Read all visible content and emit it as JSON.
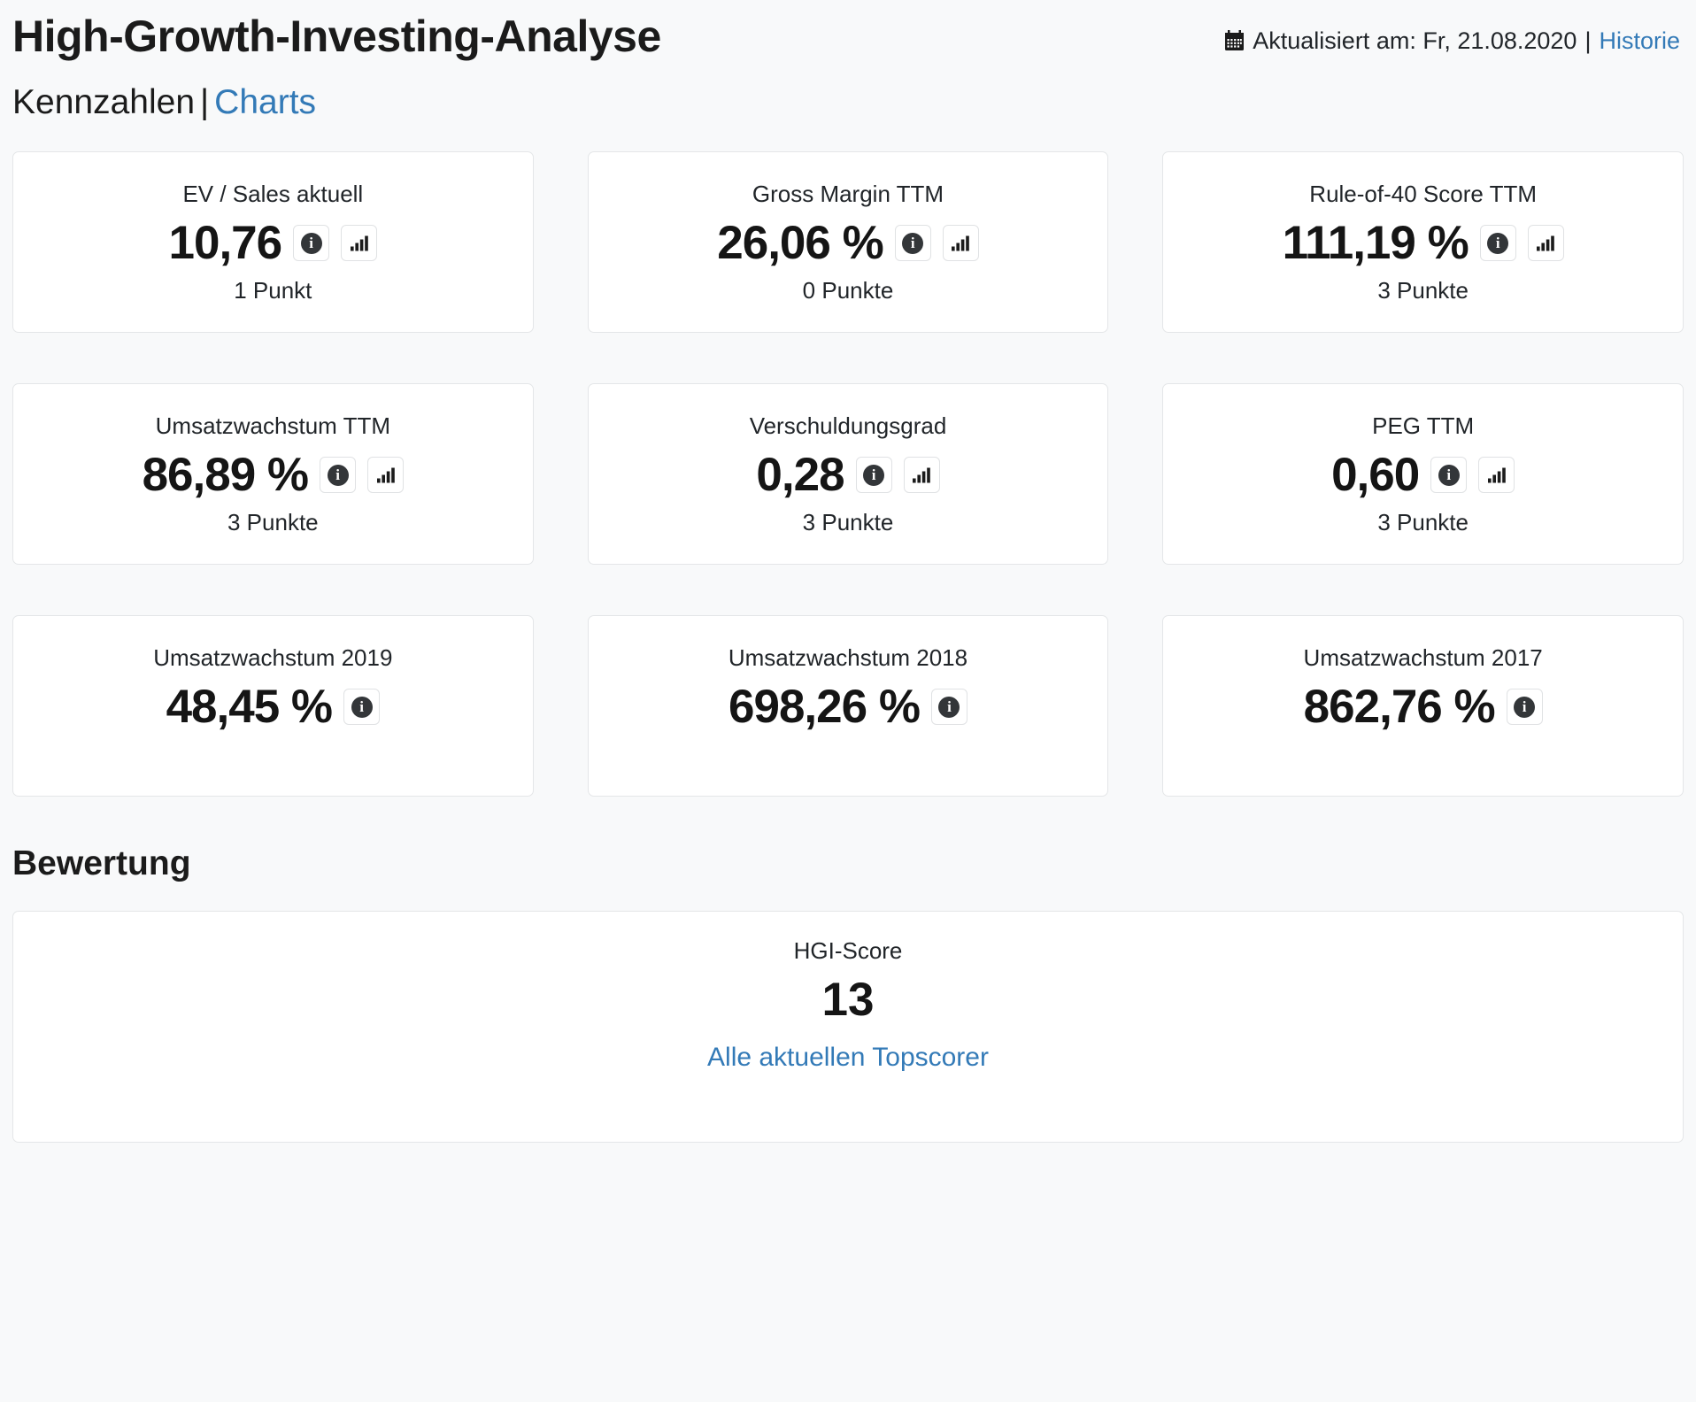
{
  "header": {
    "title": "High-Growth-Investing-Analyse",
    "calendar_icon": "calendar-icon",
    "updated_label": "Aktualisiert am: Fr, 21.08.2020",
    "separator": "|",
    "history_link": "Historie"
  },
  "subnav": {
    "active_label": "Kennzahlen",
    "divider": "|",
    "charts_link": "Charts"
  },
  "icons": {
    "info": "info-icon",
    "chart": "bar-chart-icon"
  },
  "metrics": [
    {
      "title": "EV / Sales aktuell",
      "value": "10,76",
      "points": "1 Punkt",
      "has_info": true,
      "has_chart": true
    },
    {
      "title": "Gross Margin TTM",
      "value": "26,06 %",
      "points": "0 Punkte",
      "has_info": true,
      "has_chart": true
    },
    {
      "title": "Rule-of-40 Score TTM",
      "value": "111,19 %",
      "points": "3 Punkte",
      "has_info": true,
      "has_chart": true
    },
    {
      "title": "Umsatzwachstum TTM",
      "value": "86,89 %",
      "points": "3 Punkte",
      "has_info": true,
      "has_chart": true
    },
    {
      "title": "Verschuldungsgrad",
      "value": "0,28",
      "points": "3 Punkte",
      "has_info": true,
      "has_chart": true
    },
    {
      "title": "PEG TTM",
      "value": "0,60",
      "points": "3 Punkte",
      "has_info": true,
      "has_chart": true
    },
    {
      "title": "Umsatzwachstum 2019",
      "value": "48,45 %",
      "points": "",
      "has_info": true,
      "has_chart": false
    },
    {
      "title": "Umsatzwachstum 2018",
      "value": "698,26 %",
      "points": "",
      "has_info": true,
      "has_chart": false
    },
    {
      "title": "Umsatzwachstum 2017",
      "value": "862,76 %",
      "points": "",
      "has_info": true,
      "has_chart": false
    }
  ],
  "evaluation": {
    "section_title": "Bewertung",
    "score_label": "HGI-Score",
    "score_value": "13",
    "topscorer_link": "Alle aktuellen Topscorer"
  },
  "colors": {
    "link": "#337ab7",
    "page_background": "#f8f9fa",
    "card_background": "#ffffff",
    "card_border": "#e4e6e8",
    "text": "#212529"
  }
}
